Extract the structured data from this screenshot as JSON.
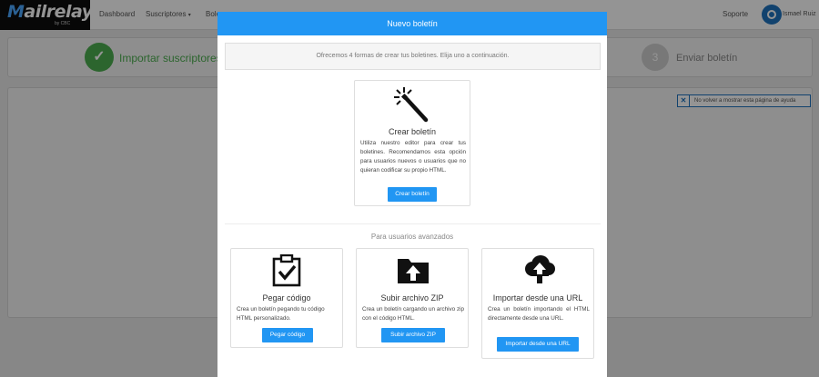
{
  "app": {
    "logo": {
      "text_prefix": "ai",
      "text_main": "lrelay",
      "tagline": "by CBC"
    },
    "nav": {
      "dashboard": "Dashboard",
      "suscriptores": "Suscriptores",
      "boletines_partial": "Bole",
      "soporte": "Soporte",
      "user_name": "Ismael Ruiz"
    },
    "steps": {
      "step1_label": "Importar suscriptores",
      "step3_number": "3",
      "step3_label": "Enviar boletín"
    },
    "help_box": {
      "text": "No volver a mostrar esta página de ayuda"
    }
  },
  "modal": {
    "title": "Nuevo boletín",
    "info": "Ofrecemos 4 formas de crear tus boletines. Elija uno a continuación.",
    "create": {
      "title": "Crear boletín",
      "description": "Utiliza nuestro editor para crear tus boletines. Recomendamos esta opción para usuarios nuevos o usuarios que no quieran codificar su propio HTML.",
      "button": "Crear boletín"
    },
    "advanced_title": "Para usuarios avanzados",
    "options": [
      {
        "title": "Pegar código",
        "description": "Crea un boletín pegando tu código HTML personalizado.",
        "button": "Pegar código"
      },
      {
        "title": "Subir archivo ZIP",
        "description": "Crea un boletín cargando un archivo zip con el código HTML.",
        "button": "Subir archivo ZIP"
      },
      {
        "title": "Importar desde una URL",
        "description": "Crea un boletín importando el HTML directamente desde una URL.",
        "button": "Importar desde una URL"
      }
    ]
  },
  "icons": {
    "magic_wand": "magic-wand-icon",
    "clipboard_check": "clipboard-check-icon",
    "folder_upload": "folder-upload-icon",
    "cloud_upload": "cloud-upload-icon",
    "check": "check-icon",
    "close": "close-icon",
    "power": "power-icon"
  },
  "colors": {
    "primary": "#2196f3",
    "success": "#4caf50",
    "logo_bg": "#0d0d0d"
  }
}
